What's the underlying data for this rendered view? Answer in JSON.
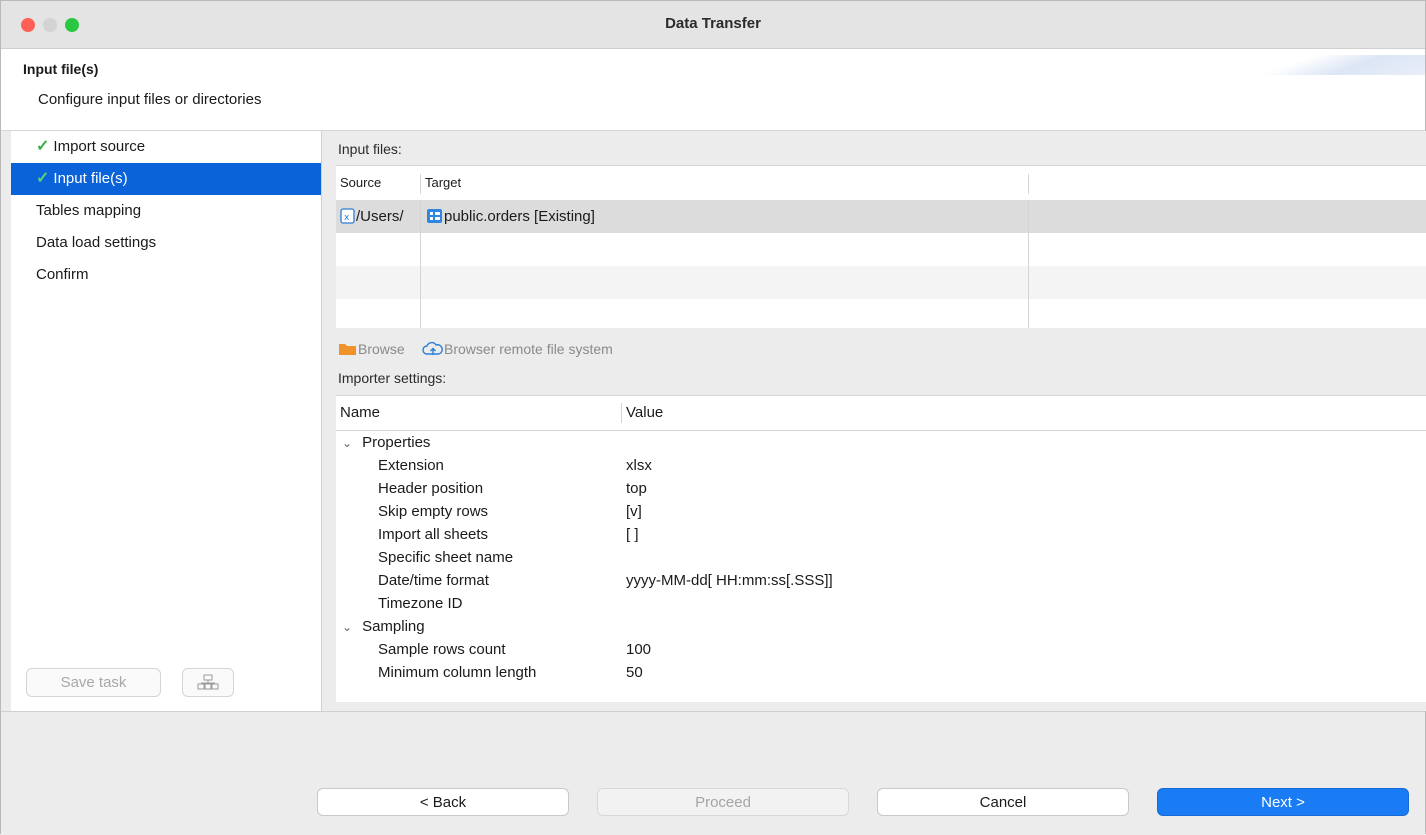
{
  "window": {
    "title": "Data Transfer"
  },
  "header": {
    "title": "Input file(s)",
    "subtitle": "Configure input files or directories"
  },
  "sidebar": {
    "items": [
      {
        "label": "Import source",
        "done": true
      },
      {
        "label": "Input file(s)",
        "done": true,
        "selected": true
      },
      {
        "label": "Tables mapping"
      },
      {
        "label": "Data load settings"
      },
      {
        "label": "Confirm"
      }
    ],
    "save_task_label": "Save task"
  },
  "input_files": {
    "label": "Input files:",
    "columns": [
      "Source",
      "Target"
    ],
    "rows": [
      {
        "source": "/Users/",
        "target": "public.orders [Existing]"
      }
    ]
  },
  "toolbar": {
    "browse_label": "Browse",
    "remote_label": "Browser remote file system"
  },
  "importer": {
    "label": "Importer settings:",
    "columns": [
      "Name",
      "Value"
    ],
    "groups": [
      {
        "name": "Properties",
        "props": [
          {
            "name": "Extension",
            "value": "xlsx"
          },
          {
            "name": "Header position",
            "value": "top"
          },
          {
            "name": "Skip empty rows",
            "value": "[v]"
          },
          {
            "name": "Import all sheets",
            "value": "[ ]"
          },
          {
            "name": "Specific sheet name",
            "value": ""
          },
          {
            "name": "Date/time format",
            "value": "yyyy-MM-dd[ HH:mm:ss[.SSS]]"
          },
          {
            "name": "Timezone ID",
            "value": ""
          }
        ]
      },
      {
        "name": "Sampling",
        "props": [
          {
            "name": "Sample rows count",
            "value": "100"
          },
          {
            "name": "Minimum column length",
            "value": "50"
          }
        ]
      }
    ]
  },
  "footer": {
    "back": "< Back",
    "proceed": "Proceed",
    "cancel": "Cancel",
    "next": "Next >"
  },
  "colors": {
    "accent": "#0a63d9",
    "primary_button": "#1a7cf5",
    "check": "#3fae49"
  }
}
